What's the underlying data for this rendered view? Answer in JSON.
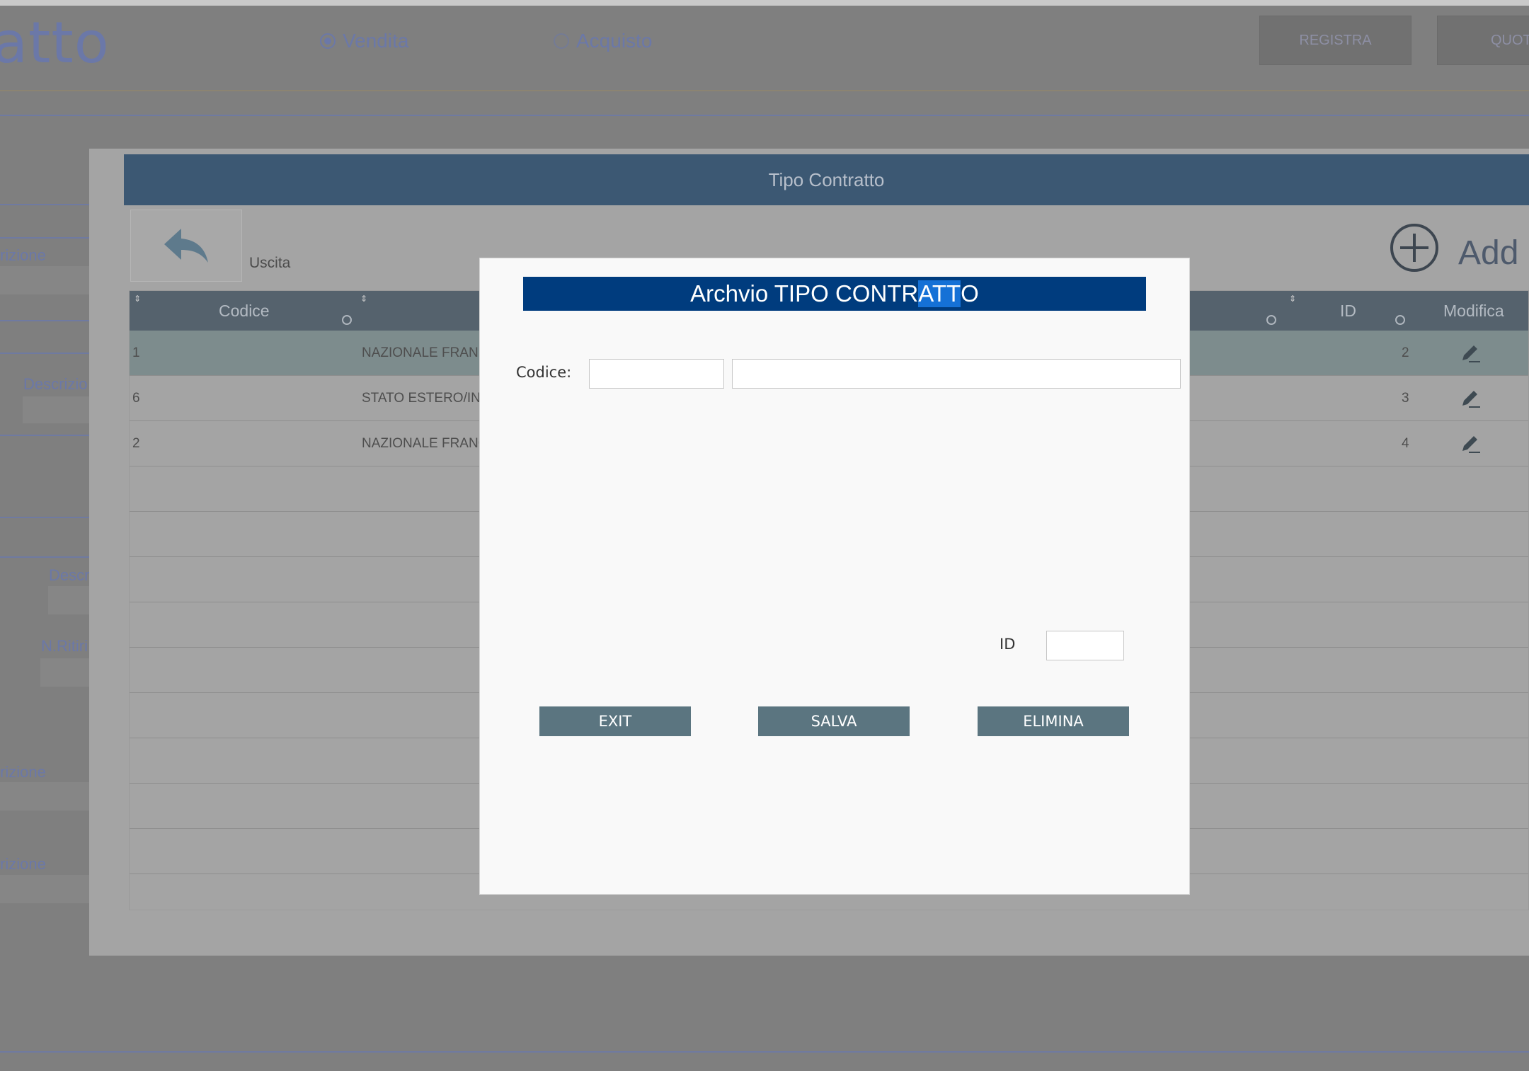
{
  "background": {
    "page_title": "atto",
    "radio_options": [
      {
        "label": "Vendita",
        "selected": true
      },
      {
        "label": "Acquisto",
        "selected": false
      }
    ],
    "top_buttons": [
      "REGISTRA",
      "QUOT"
    ],
    "left_labels": [
      "rizione",
      "Descrizio",
      "Descr",
      "N.Ritiri",
      "rizione",
      "rizione"
    ]
  },
  "panel": {
    "title": "Tipo Contratto",
    "back_label": "Uscita",
    "add_label": "Add",
    "columns": {
      "codice": "Codice",
      "id": "ID",
      "modifica": "Modifica"
    },
    "rows": [
      {
        "code": "1",
        "description": "NAZIONALE FRAN",
        "id": "2",
        "selected": true
      },
      {
        "code": "6",
        "description": "STATO ESTERO/INT",
        "id": "3",
        "selected": false
      },
      {
        "code": "2",
        "description": "NAZIONALE FRANC",
        "id": "4",
        "selected": false
      }
    ]
  },
  "modal": {
    "title_part1": "Archvio TIPO CONTR",
    "title_highlight": "ATT",
    "title_part2": "O",
    "codice_label": "Codice:",
    "codice_value": "",
    "descrizione_value": "",
    "id_label": "ID",
    "id_value": "",
    "buttons": {
      "exit": "EXIT",
      "salva": "SALVA",
      "elimina": "ELIMINA"
    }
  },
  "colors": {
    "modal_title_bg": "#003c7e",
    "panel_header_bg": "#3c5873",
    "button_bg": "#5b7580",
    "overlay": "#7f7f7f"
  }
}
